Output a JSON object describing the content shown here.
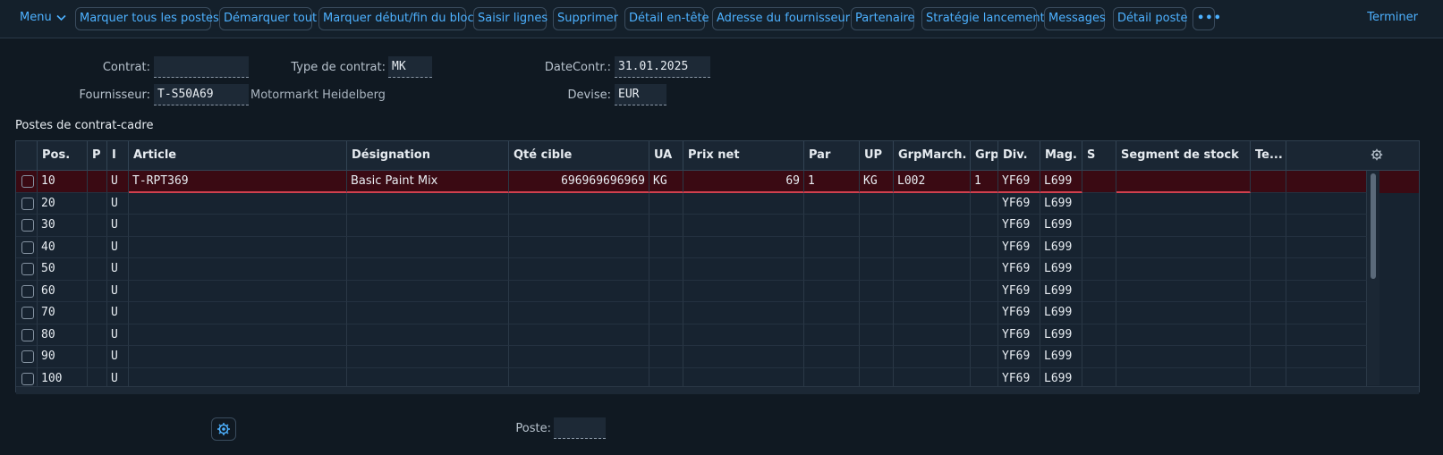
{
  "toolbar": {
    "menu_label": "Menu",
    "buttons": [
      "Marquer tous les postes",
      "Démarquer tout",
      "Marquer début/fin du bloc",
      "Saisir lignes",
      "Supprimer",
      "Détail en-tête",
      "Adresse du fournisseur",
      "Partenaire",
      "Stratégie lancement",
      "Messages",
      "Détail poste"
    ],
    "more_label": "•••",
    "end_label": "Terminer"
  },
  "header": {
    "contract_label": "Contrat:",
    "contract_value": "",
    "contract_type_label": "Type de contrat:",
    "contract_type_value": "MK",
    "date_label": "DateContr.:",
    "date_value": "31.01.2025",
    "vendor_label": "Fournisseur:",
    "vendor_value": "T-S50A69",
    "vendor_name": "Motormarkt Heidelberg",
    "currency_label": "Devise:",
    "currency_value": "EUR"
  },
  "section_title": "Postes de contrat-cadre",
  "table": {
    "columns": [
      "Pos.",
      "P",
      "I",
      "Article",
      "Désignation",
      "Qté cible",
      "UA",
      "Prix net",
      "Par",
      "UP",
      "GrpMarch.",
      "Grpe",
      "Div.",
      "Mag.",
      "S",
      "Segment de stock",
      "Te..."
    ],
    "rows": [
      {
        "pos": "10",
        "p": "",
        "i": "U",
        "article": "T-RPT369",
        "designation": "Basic Paint Mix",
        "qty": "696969696969",
        "ua": "KG",
        "price": "69",
        "per": "1",
        "up": "KG",
        "matgrp": "L002",
        "grp": "1",
        "div": "YF69",
        "mag": "L699",
        "s": "",
        "segment": "",
        "te": ""
      },
      {
        "pos": "20",
        "p": "",
        "i": "U",
        "article": "",
        "designation": "",
        "qty": "",
        "ua": "",
        "price": "",
        "per": "",
        "up": "",
        "matgrp": "",
        "grp": "",
        "div": "YF69",
        "mag": "L699",
        "s": "",
        "segment": "",
        "te": ""
      },
      {
        "pos": "30",
        "p": "",
        "i": "U",
        "article": "",
        "designation": "",
        "qty": "",
        "ua": "",
        "price": "",
        "per": "",
        "up": "",
        "matgrp": "",
        "grp": "",
        "div": "YF69",
        "mag": "L699",
        "s": "",
        "segment": "",
        "te": ""
      },
      {
        "pos": "40",
        "p": "",
        "i": "U",
        "article": "",
        "designation": "",
        "qty": "",
        "ua": "",
        "price": "",
        "per": "",
        "up": "",
        "matgrp": "",
        "grp": "",
        "div": "YF69",
        "mag": "L699",
        "s": "",
        "segment": "",
        "te": ""
      },
      {
        "pos": "50",
        "p": "",
        "i": "U",
        "article": "",
        "designation": "",
        "qty": "",
        "ua": "",
        "price": "",
        "per": "",
        "up": "",
        "matgrp": "",
        "grp": "",
        "div": "YF69",
        "mag": "L699",
        "s": "",
        "segment": "",
        "te": ""
      },
      {
        "pos": "60",
        "p": "",
        "i": "U",
        "article": "",
        "designation": "",
        "qty": "",
        "ua": "",
        "price": "",
        "per": "",
        "up": "",
        "matgrp": "",
        "grp": "",
        "div": "YF69",
        "mag": "L699",
        "s": "",
        "segment": "",
        "te": ""
      },
      {
        "pos": "70",
        "p": "",
        "i": "U",
        "article": "",
        "designation": "",
        "qty": "",
        "ua": "",
        "price": "",
        "per": "",
        "up": "",
        "matgrp": "",
        "grp": "",
        "div": "YF69",
        "mag": "L699",
        "s": "",
        "segment": "",
        "te": ""
      },
      {
        "pos": "80",
        "p": "",
        "i": "U",
        "article": "",
        "designation": "",
        "qty": "",
        "ua": "",
        "price": "",
        "per": "",
        "up": "",
        "matgrp": "",
        "grp": "",
        "div": "YF69",
        "mag": "L699",
        "s": "",
        "segment": "",
        "te": ""
      },
      {
        "pos": "90",
        "p": "",
        "i": "U",
        "article": "",
        "designation": "",
        "qty": "",
        "ua": "",
        "price": "",
        "per": "",
        "up": "",
        "matgrp": "",
        "grp": "",
        "div": "YF69",
        "mag": "L699",
        "s": "",
        "segment": "",
        "te": ""
      },
      {
        "pos": "100",
        "p": "",
        "i": "U",
        "article": "",
        "designation": "",
        "qty": "",
        "ua": "",
        "price": "",
        "per": "",
        "up": "",
        "matgrp": "",
        "grp": "",
        "div": "YF69",
        "mag": "L699",
        "s": "",
        "segment": "",
        "te": ""
      }
    ]
  },
  "footer": {
    "item_label": "Poste:",
    "item_value": ""
  },
  "icons": {
    "menu_chevron": "chevron-down-icon",
    "table_settings": "gear-icon",
    "footer_settings": "gear-icon"
  },
  "colors": {
    "accent": "#4db1ff",
    "selected_row": "#3a0a13",
    "selected_underline": "#d0404e"
  }
}
